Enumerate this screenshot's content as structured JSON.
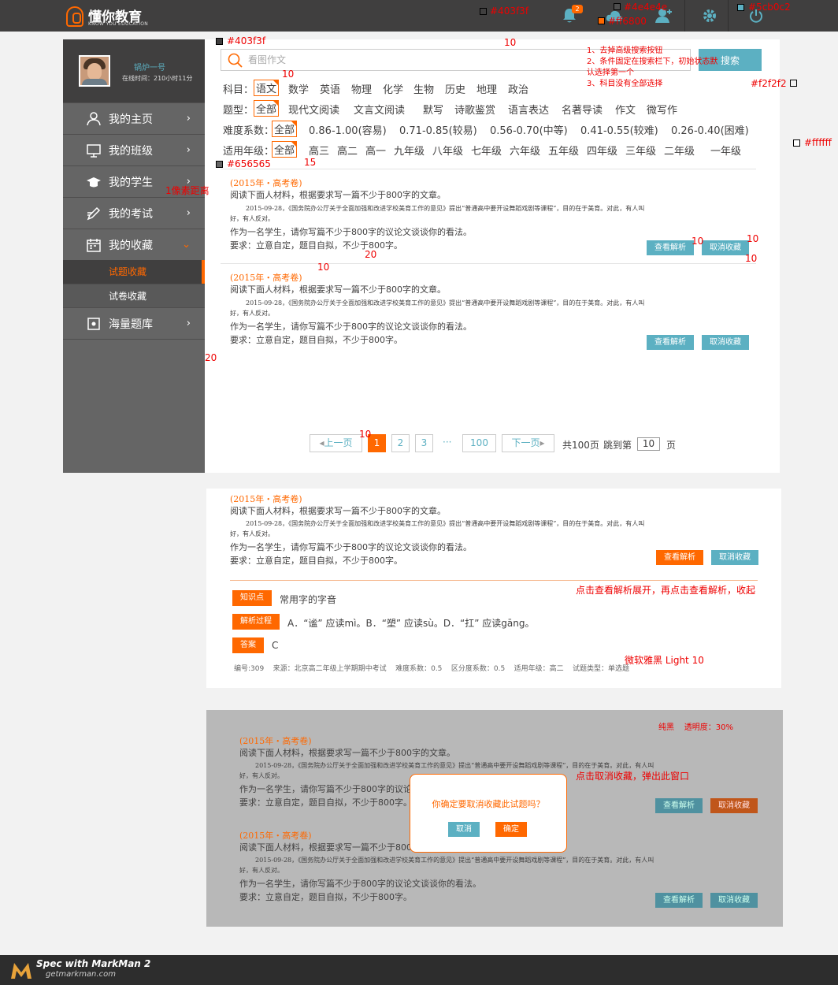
{
  "header": {
    "logo_name": "懂你教育",
    "logo_sub": "KNOW YOU EDUCATION",
    "notification_count": "2",
    "icons": [
      "bell-icon",
      "cloud-icon",
      "user-add-icon",
      "gear-icon",
      "power-icon"
    ]
  },
  "sidebar": {
    "username": "锅炉一号",
    "online_time": "在线时间：210小时11分",
    "items": [
      {
        "label": "我的主页",
        "icon": "user-icon"
      },
      {
        "label": "我的班级",
        "icon": "monitor-icon"
      },
      {
        "label": "我的学生",
        "icon": "graduation-cap-icon"
      },
      {
        "label": "我的考试",
        "icon": "pen-icon"
      },
      {
        "label": "我的收藏",
        "icon": "calendar-icon"
      },
      {
        "label": "海量题库",
        "icon": "puzzle-icon"
      }
    ],
    "sub_items": [
      "试题收藏",
      "试卷收藏"
    ]
  },
  "search": {
    "placeholder": "看图作文",
    "button_label": "搜索"
  },
  "filters": {
    "subject": {
      "label": "科目：",
      "options": [
        "语文",
        "数学",
        "英语",
        "物理",
        "化学",
        "生物",
        "历史",
        "地理",
        "政治"
      ]
    },
    "type": {
      "label": "题型：",
      "options": [
        "全部",
        "现代文阅读",
        "文言文阅读",
        "默写",
        "诗歌鉴赏",
        "语言表达",
        "名著导读",
        "作文",
        "微写作"
      ]
    },
    "difficulty": {
      "label": "难度系数：",
      "options": [
        "全部",
        "0.86-1.00(容易)",
        "0.71-0.85(较易)",
        "0.56-0.70(中等)",
        "0.41-0.55(较难)",
        "0.26-0.40(困难)"
      ]
    },
    "grade": {
      "label": "适用年级：",
      "options": [
        "全部",
        "高三",
        "高二",
        "高一",
        "九年级",
        "八年级",
        "七年级",
        "六年级",
        "五年级",
        "四年级",
        "三年级",
        "二年级",
        "一年级"
      ]
    }
  },
  "question": {
    "source": "(2015年・高考卷)",
    "line1": "阅读下面人材料，根据要求写一篇不少于800字的文章。",
    "line2": "2015-09-28，《国务院办公厅关于全面加强和改进学校美育工作的意见》提出“普通高中要开设舞蹈戏剧等课程”，目的在于美育。对此，有人叫",
    "line3": "好，有人反对。",
    "line4": "作为一名学生，请你写篇不少于800字的议论文谈谈你的看法。",
    "line5": "要求：立意自定，题目自拟，不少于800字。",
    "btn_analysis": "查看解析",
    "btn_uncollect": "取消收藏"
  },
  "pagination": {
    "prev": "上一页",
    "pages": [
      "1",
      "2",
      "3"
    ],
    "ellipsis": "···",
    "last": "100",
    "next": "下一页",
    "total": "共100页",
    "jump_label": "跳到第",
    "jump_value": "10",
    "jump_suffix": "页"
  },
  "detail": {
    "knowledge_tag": "知识点",
    "knowledge_text": "常用字的字音",
    "analysis_tag": "解析过程",
    "analysis_text": "A．“谧” 应读mì。B．“塑” 应读sù。D．“扛” 应读gāng。",
    "answer_tag": "答案",
    "answer_text": "C",
    "meta": "编号:309    来源：北京高二年级上学期期中考试    难度系数：0.5    区分度系数：0.5    适用年级：高二    试题类型：单选题"
  },
  "modal": {
    "message": "你确定要取消收藏此试题吗？",
    "cancel": "取消",
    "confirm": "确定"
  },
  "annotations": {
    "c1": "#403f3f",
    "c2": "#4e4e4e",
    "c3": "#5cb0c2",
    "c4": "#ff6800",
    "c5": "#403f3f",
    "c6": "#f2f2f2",
    "c7": "#ffffff",
    "c8": "#656565",
    "note_search": "1、去掉高级搜索按钮\n2、条件固定在搜索栏下，初始状态默\n认选择第一个\n3、科目没有全部选择",
    "note_pixel": "1像素距离",
    "note_expand": "点击查看解析展开，再点击查看解析，收起",
    "note_font": "微软雅黑 Light  10",
    "note_black": "纯黑    透明度：30%",
    "note_popup": "点击取消收藏，弹出此窗口",
    "n10": "10",
    "n15": "15",
    "n20": "20"
  },
  "footer": {
    "title": "Spec with MarkMan 2",
    "url": "getmarkman.com"
  },
  "colors": {
    "dark": "#403f3f",
    "gray": "#656565",
    "blue": "#5cb0c2",
    "orange": "#ff6800",
    "bg": "#f2f2f2"
  }
}
